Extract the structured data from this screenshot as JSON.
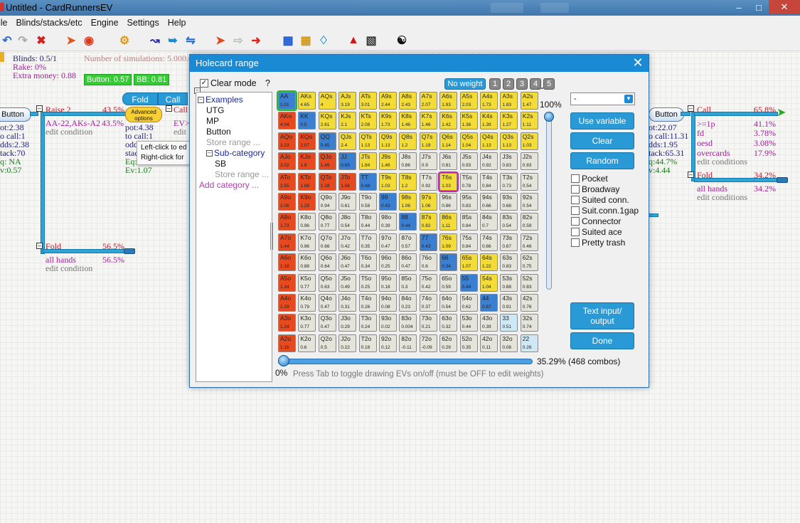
{
  "window": {
    "title": "Untitled - CardRunnersEV"
  },
  "menu": [
    "ile",
    "Blinds/stacks/etc",
    "Engine",
    "Settings",
    "Help"
  ],
  "header_info": {
    "blinds": "Blinds: 0.5/1",
    "rake": "Rake: 0%",
    "extra_money": "Extra money: 0.88",
    "simulations": "Number of simulations: 5.000.0",
    "button_stack": "Button: 0.57",
    "bb_stack": "BB: 0.81"
  },
  "tree_left": {
    "button_label": "Button",
    "raise_label": "Raise 2",
    "raise_pct": "43.5%",
    "raise_range": "AA-22,AKs-A2",
    "raise_range_pct": "43.5%",
    "edit_condition": "edit condition",
    "stats": [
      "ot:2.38",
      "o call:1",
      "dds:2.38",
      "tack:70",
      "q: NA",
      "v:0.57"
    ],
    "fold_label": "Fold",
    "fold_pct": "56.5%",
    "all_hands": "all hands",
    "all_hands_pct": "56.5%",
    "edit_condition_2": "edit condition",
    "fold_btn": "Fold",
    "call_btn": "Call",
    "advanced_options": "Advanced options",
    "mid_stats": [
      "pot:4.38",
      "to call:1",
      "odd",
      "stac",
      "Eq:",
      "Ev:1.07"
    ],
    "call_stub": "Call",
    "ev_stub": "EV>",
    "edit_stub": "edit",
    "tooltip_1": "Left-click to ed",
    "tooltip_2": "Right-click for"
  },
  "tree_right": {
    "button_label": "Button",
    "stats": [
      "ot:22.07",
      "o call:11.31",
      "dds:1.95",
      "tack:65.31",
      "q:44.7%",
      "v:4.44"
    ],
    "call_label": "Call",
    "call_pct": "65.8%",
    "conditions": [
      {
        "label": ">=1p",
        "pct": "41.1%"
      },
      {
        "label": "fd",
        "pct": "3.78%"
      },
      {
        "label": "oesd",
        "pct": "3.08%"
      },
      {
        "label": "overcards",
        "pct": "17.9%"
      }
    ],
    "edit_condition": "edit conditions",
    "fold_label": "Fold",
    "fold_pct": "34.2%",
    "all_hands": "all hands",
    "all_hands_pct": "34.2%",
    "edit_condition_2": "edit conditions"
  },
  "dialog": {
    "title": "Holecard range",
    "clear_mode": "Clear mode",
    "help": "?",
    "weights": [
      "No weight",
      "1",
      "2",
      "3",
      "4",
      "5"
    ],
    "tree": {
      "examples": "Examples",
      "utg": "UTG",
      "mp": "MP",
      "button": "Button",
      "store_range": "Store range ...",
      "sub_category": "Sub-category",
      "sb": "SB",
      "store_range_2": "Store range ...",
      "add_category": "Add category ..."
    },
    "slider_top": "100%",
    "slider_bottom": "0%",
    "combos": "35.29% (468 combos)",
    "hint": "Press Tab to toggle drawing EVs on/off (must be OFF to edit weights)",
    "select_value": "-",
    "buttons": {
      "use_variable": "Use variable",
      "clear": "Clear",
      "random": "Random",
      "text_io": "Text input/ output",
      "done": "Done"
    },
    "categories": [
      "Pocket",
      "Broadway",
      "Suited conn.",
      "Suit.conn.1gap",
      "Connector",
      "Suited ace",
      "Pretty trash"
    ],
    "colors": {
      "selected": "#f3dc38",
      "offsuit_sel": "#e84a20",
      "pair_sel": "#3a7fd0",
      "unselected": "#e4e4da",
      "pair_unsel": "#cfe8f6"
    },
    "grid": [
      [
        [
          "AA",
          "1.01"
        ],
        [
          "AKs",
          "4.65"
        ],
        [
          "AQs",
          "4"
        ],
        [
          "AJs",
          "3.19"
        ],
        [
          "ATs",
          "3.01"
        ],
        [
          "A9s",
          "2.44"
        ],
        [
          "A8s",
          "2.43"
        ],
        [
          "A7s",
          "2.07"
        ],
        [
          "A6s",
          "1.93"
        ],
        [
          "A5s",
          "2.03"
        ],
        [
          "A4s",
          "1.73"
        ],
        [
          "A3s",
          "1.83"
        ],
        [
          "A2s",
          "1.47"
        ]
      ],
      [
        [
          "AKo",
          "4.04"
        ],
        [
          "KK",
          "0.5"
        ],
        [
          "KQs",
          "2.61"
        ],
        [
          "KJs",
          "2.1"
        ],
        [
          "KTs",
          "2.08"
        ],
        [
          "K9s",
          "1.73"
        ],
        [
          "K8s",
          "1.46"
        ],
        [
          "K7s",
          "1.46"
        ],
        [
          "K6s",
          "1.42"
        ],
        [
          "K5s",
          "1.36"
        ],
        [
          "K4s",
          "1.39"
        ],
        [
          "K3s",
          "1.27"
        ],
        [
          "K2s",
          "1.11"
        ]
      ],
      [
        [
          "AQo",
          "3.23"
        ],
        [
          "KQo",
          "2.07"
        ],
        [
          "QQ",
          "0.45"
        ],
        [
          "QJs",
          "2.4"
        ],
        [
          "QTs",
          "1.13"
        ],
        [
          "Q9s",
          "1.13"
        ],
        [
          "Q8s",
          "1.2"
        ],
        [
          "Q7s",
          "1.19"
        ],
        [
          "Q6s",
          "1.14"
        ],
        [
          "Q5s",
          "1.04"
        ],
        [
          "Q4s",
          "1.13"
        ],
        [
          "Q3s",
          "1.13"
        ],
        [
          "Q2s",
          "1.03"
        ]
      ],
      [
        [
          "AJo",
          "3.02"
        ],
        [
          "KJo",
          "1.9"
        ],
        [
          "QJo",
          "1.46"
        ],
        [
          "JJ",
          "0.65"
        ],
        [
          "JTs",
          "1.84"
        ],
        [
          "J9s",
          "1.46"
        ],
        [
          "J8s",
          "0.86"
        ],
        [
          "J7s",
          "0.9"
        ],
        [
          "J6s",
          "0.81"
        ],
        [
          "J5s",
          "0.93"
        ],
        [
          "J4s",
          "0.92"
        ],
        [
          "J3s",
          "0.83"
        ],
        [
          "J2s",
          "0.83"
        ]
      ],
      [
        [
          "ATo",
          "2.55"
        ],
        [
          "KTo",
          "1.68"
        ],
        [
          "QTo",
          "1.18"
        ],
        [
          "JTo",
          "1.06"
        ],
        [
          "TT",
          "0.48"
        ],
        [
          "T9s",
          "1.03"
        ],
        [
          "T8s",
          "1.2"
        ],
        [
          "T7s",
          "0.92"
        ],
        [
          "T6s",
          "1.03"
        ],
        [
          "T5s",
          "0.78"
        ],
        [
          "T4s",
          "0.84"
        ],
        [
          "T3s",
          "0.73"
        ],
        [
          "T2s",
          "0.54"
        ]
      ],
      [
        [
          "A9o",
          "2.06"
        ],
        [
          "K9o",
          "1.29"
        ],
        [
          "Q9o",
          "0.94"
        ],
        [
          "J9o",
          "0.61"
        ],
        [
          "T9o",
          "0.58"
        ],
        [
          "99",
          "0.43"
        ],
        [
          "98s",
          "1.06"
        ],
        [
          "97s",
          "1.06"
        ],
        [
          "96s",
          "0.86"
        ],
        [
          "95s",
          "0.83"
        ],
        [
          "94s",
          "0.66"
        ],
        [
          "93s",
          "0.68"
        ],
        [
          "92s",
          "0.54"
        ]
      ],
      [
        [
          "A8o",
          "1.73"
        ],
        [
          "K8o",
          "0.96"
        ],
        [
          "Q8o",
          "0.77"
        ],
        [
          "J8o",
          "0.54"
        ],
        [
          "T8o",
          "0.44"
        ],
        [
          "98o",
          "0.39"
        ],
        [
          "88",
          "0.44"
        ],
        [
          "87s",
          "0.82"
        ],
        [
          "86s",
          "1.11"
        ],
        [
          "85s",
          "0.84"
        ],
        [
          "84s",
          "0.7"
        ],
        [
          "83s",
          "0.54"
        ],
        [
          "82s",
          "0.59"
        ]
      ],
      [
        [
          "A7o",
          "1.44"
        ],
        [
          "K7o",
          "0.96"
        ],
        [
          "Q7o",
          "0.66"
        ],
        [
          "J7o",
          "0.42"
        ],
        [
          "T7o",
          "0.35"
        ],
        [
          "97o",
          "0.47"
        ],
        [
          "87o",
          "0.57"
        ],
        [
          "77",
          "0.43"
        ],
        [
          "76s",
          "1.09"
        ],
        [
          "75s",
          "0.84"
        ],
        [
          "74s",
          "0.66"
        ],
        [
          "73s",
          "0.67"
        ],
        [
          "72s",
          "0.46"
        ]
      ],
      [
        [
          "A6o",
          "1.18"
        ],
        [
          "K6o",
          "0.88"
        ],
        [
          "Q6o",
          "0.64"
        ],
        [
          "J6o",
          "0.47"
        ],
        [
          "T6o",
          "0.34"
        ],
        [
          "96o",
          "0.25"
        ],
        [
          "86o",
          "0.47"
        ],
        [
          "76o",
          "0.6"
        ],
        [
          "66",
          "0.34"
        ],
        [
          "65s",
          "1.07"
        ],
        [
          "64s",
          "1.22"
        ],
        [
          "63s",
          "0.83"
        ],
        [
          "62s",
          "0.75"
        ]
      ],
      [
        [
          "A5o",
          "1.34"
        ],
        [
          "K5o",
          "0.77"
        ],
        [
          "Q5o",
          "0.63"
        ],
        [
          "J5o",
          "0.49"
        ],
        [
          "T5o",
          "0.25"
        ],
        [
          "95o",
          "0.18"
        ],
        [
          "85o",
          "0.3"
        ],
        [
          "75o",
          "0.42"
        ],
        [
          "65o",
          "0.59"
        ],
        [
          "55",
          "0.44"
        ],
        [
          "54s",
          "1.04"
        ],
        [
          "53s",
          "0.88"
        ],
        [
          "52s",
          "0.83"
        ]
      ],
      [
        [
          "A4o",
          "1.29"
        ],
        [
          "K4o",
          "0.79"
        ],
        [
          "Q4o",
          "0.47"
        ],
        [
          "J4o",
          "0.31"
        ],
        [
          "T4o",
          "0.26"
        ],
        [
          "94o",
          "0.08"
        ],
        [
          "84o",
          "0.23"
        ],
        [
          "74o",
          "0.37"
        ],
        [
          "64o",
          "0.54"
        ],
        [
          "54o",
          "0.62"
        ],
        [
          "44",
          "0.87"
        ],
        [
          "43s",
          "0.91"
        ],
        [
          "42s",
          "0.76"
        ]
      ],
      [
        [
          "A3o",
          "1.24"
        ],
        [
          "K3o",
          "0.77"
        ],
        [
          "Q3o",
          "0.47"
        ],
        [
          "J3o",
          "0.29"
        ],
        [
          "T3o",
          "0.24"
        ],
        [
          "93o",
          "0.02"
        ],
        [
          "83o",
          "0.004"
        ],
        [
          "73o",
          "0.21"
        ],
        [
          "63o",
          "0.32"
        ],
        [
          "53o",
          "0.44"
        ],
        [
          "43o",
          "0.39"
        ],
        [
          "33",
          "0.51"
        ],
        [
          "32s",
          "0.74"
        ]
      ],
      [
        [
          "A2o",
          "1.16"
        ],
        [
          "K2o",
          "0.6"
        ],
        [
          "Q2o",
          "0.5"
        ],
        [
          "J2o",
          "0.22"
        ],
        [
          "T2o",
          "0.18"
        ],
        [
          "92o",
          "0.12"
        ],
        [
          "82o",
          "-0.11"
        ],
        [
          "72o",
          "-0.09"
        ],
        [
          "62o",
          "0.29"
        ],
        [
          "52o",
          "0.35"
        ],
        [
          "42o",
          "0.11"
        ],
        [
          "32o",
          "0.08"
        ],
        [
          "22",
          "0.26"
        ]
      ]
    ]
  }
}
